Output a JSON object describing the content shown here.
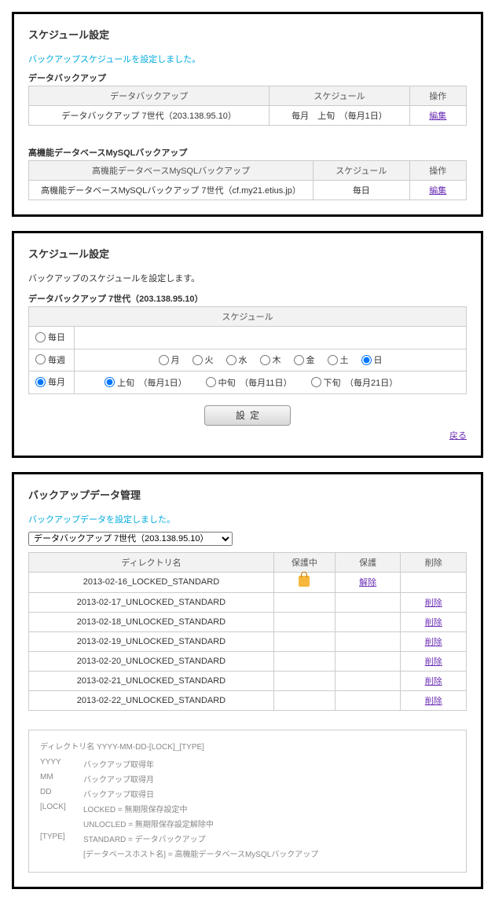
{
  "panel1": {
    "title": "スケジュール設定",
    "flash": "バックアップスケジュールを設定しました。",
    "sectionA": {
      "heading": "データバックアップ",
      "cols": {
        "name": "データバックアップ",
        "sched": "スケジュール",
        "op": "操作"
      },
      "row": {
        "name": "データバックアップ 7世代（203.138.95.10）",
        "sched": "毎月　上旬　（毎月1日）",
        "op": "編集"
      }
    },
    "sectionB": {
      "heading": "高機能データベースMySQLバックアップ",
      "cols": {
        "name": "高機能データベースMySQLバックアップ",
        "sched": "スケジュール",
        "op": "操作"
      },
      "row": {
        "name": "高機能データベースMySQLバックアップ 7世代（cf.my21.etius.jp）",
        "sched": "毎日",
        "op": "編集"
      }
    }
  },
  "panel2": {
    "title": "スケジュール設定",
    "desc": "バックアップのスケジュールを設定します。",
    "heading": "データバックアップ 7世代（203.138.95.10）",
    "col_sched": "スケジュール",
    "rows": {
      "daily": "毎日",
      "weekly": "毎週",
      "monthly": "毎月"
    },
    "weekdays": {
      "mon": "月",
      "tue": "火",
      "wed": "水",
      "thu": "木",
      "fri": "金",
      "sat": "土",
      "sun": "日"
    },
    "month_opts": {
      "joujun": "上旬　（毎月1日）",
      "chuujun": "中旬　（毎月11日）",
      "gejun": "下旬　（毎月21日）"
    },
    "submit": "設定",
    "back": "戻る"
  },
  "panel3": {
    "title": "バックアップデータ管理",
    "flash": "バックアップデータを設定しました。",
    "select": "データバックアップ 7世代（203.138.95.10）",
    "cols": {
      "dir": "ディレクトリ名",
      "locking": "保護中",
      "lock": "保護",
      "del": "削除"
    },
    "rows": [
      {
        "dir": "2013-02-16_LOCKED_STANDARD",
        "locked": true,
        "action": "解除"
      },
      {
        "dir": "2013-02-17_UNLOCKED_STANDARD",
        "locked": false,
        "action": "削除"
      },
      {
        "dir": "2013-02-18_UNLOCKED_STANDARD",
        "locked": false,
        "action": "削除"
      },
      {
        "dir": "2013-02-19_UNLOCKED_STANDARD",
        "locked": false,
        "action": "削除"
      },
      {
        "dir": "2013-02-20_UNLOCKED_STANDARD",
        "locked": false,
        "action": "削除"
      },
      {
        "dir": "2013-02-21_UNLOCKED_STANDARD",
        "locked": false,
        "action": "削除"
      },
      {
        "dir": "2013-02-22_UNLOCKED_STANDARD",
        "locked": false,
        "action": "削除"
      }
    ],
    "legend": {
      "title": "ディレクトリ名 YYYY-MM-DD-[LOCK]_[TYPE]",
      "items": [
        {
          "k": "YYYY",
          "v": "バックアップ取得年"
        },
        {
          "k": "MM",
          "v": "バックアップ取得月"
        },
        {
          "k": "DD",
          "v": "バックアップ取得日"
        },
        {
          "k": "[LOCK]",
          "v": "LOCKED = 無期限保存設定中"
        },
        {
          "k": "",
          "v": "UNLOCLED = 無期限保存設定解除中"
        },
        {
          "k": "[TYPE]",
          "v": "STANDARD = データバックアップ"
        },
        {
          "k": "",
          "v": "[データベースホスト名] = 高機能データベースMySQLバックアップ"
        }
      ]
    }
  }
}
